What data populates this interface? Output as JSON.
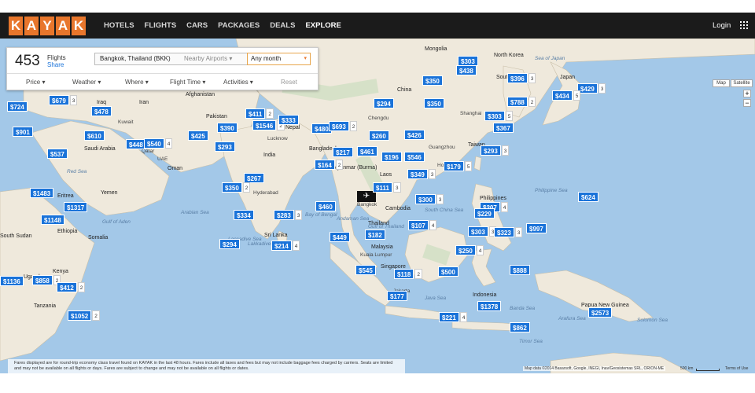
{
  "header": {
    "logo_letters": [
      "K",
      "A",
      "Y",
      "A",
      "K"
    ],
    "nav": [
      "HOTELS",
      "FLIGHTS",
      "CARS",
      "PACKAGES",
      "DEALS",
      "EXPLORE"
    ],
    "active_nav": "EXPLORE",
    "login": "Login"
  },
  "panel": {
    "count": "453",
    "flights_label": "Flights",
    "share_label": "Share",
    "origin": "Bangkok, Thailand (BKK)",
    "nearby": "Nearby Airports",
    "month": "Any month",
    "filters": [
      "Price",
      "Weather",
      "Where",
      "Flight Time",
      "Activities"
    ],
    "reset": "Reset"
  },
  "map_controls": {
    "map": "Map",
    "satellite": "Satellite",
    "zoom_in": "+",
    "zoom_out": "−"
  },
  "colors": {
    "pin": "#1a73d9",
    "water": "#a3c8e8",
    "land": "#efe9dc",
    "logo": "#e8762c"
  },
  "labels": {
    "countries": [
      "Iraq",
      "Iran",
      "Afghanistan",
      "Pakistan",
      "Saudi Arabia",
      "Yemen",
      "Eritrea",
      "Ethiopia",
      "South Sudan",
      "Kenya",
      "Tanzania",
      "India",
      "Nepal",
      "Bangladesh",
      "Myanmar (Burma)",
      "Thailand",
      "Laos",
      "Cambodia",
      "Sri Lanka",
      "Malaysia",
      "Singapore",
      "Indonesia",
      "Papua New Guinea",
      "China",
      "Mongolia",
      "North Korea",
      "South Korea",
      "Japan",
      "Taiwan",
      "Philippines",
      "Hong Kong",
      "Guangzhou",
      "Shanghai",
      "Chengdu",
      "Lucknow",
      "Hyderabad",
      "Jakarta",
      "Kuala Lumpur",
      "Lakkadives",
      "Bangkok",
      "Gulf of Thailand",
      "Red Sea",
      "Arabian Sea",
      "Bay of Bengal",
      "Andaman Sea",
      "Philippine Sea",
      "Java Sea",
      "Banda Sea",
      "Timor Sea",
      "Arafura Sea",
      "Solomon Sea",
      "Sea of Japan",
      "South China Sea",
      "Laccadive Sea",
      "Gulf of Aden",
      "Somalia",
      "Uganda",
      "Qatar",
      "Kuwait",
      "Oman",
      "UAE"
    ]
  },
  "pins": [
    {
      "p": "$303",
      "c": ""
    },
    {
      "p": "$438",
      "c": ""
    },
    {
      "p": "$396",
      "c": "3"
    },
    {
      "p": "$350",
      "c": ""
    },
    {
      "p": "$429",
      "c": "3"
    },
    {
      "p": "$679",
      "c": "3"
    },
    {
      "p": "$724",
      "c": ""
    },
    {
      "p": "$478",
      "c": ""
    },
    {
      "p": "$411",
      "c": "2"
    },
    {
      "p": "$294",
      "c": ""
    },
    {
      "p": "$350",
      "c": ""
    },
    {
      "p": "$788",
      "c": "2"
    },
    {
      "p": "$434",
      "c": "5"
    },
    {
      "p": "$1546",
      "c": "2"
    },
    {
      "p": "$333",
      "c": ""
    },
    {
      "p": "$390",
      "c": ""
    },
    {
      "p": "$480",
      "c": ""
    },
    {
      "p": "$693",
      "c": "2"
    },
    {
      "p": "$303",
      "c": "5"
    },
    {
      "p": "$367",
      "c": ""
    },
    {
      "p": "$901",
      "c": ""
    },
    {
      "p": "$610",
      "c": ""
    },
    {
      "p": "$425",
      "c": ""
    },
    {
      "p": "$448",
      "c": ""
    },
    {
      "p": "$540",
      "c": "4"
    },
    {
      "p": "$293",
      "c": ""
    },
    {
      "p": "$260",
      "c": ""
    },
    {
      "p": "$426",
      "c": ""
    },
    {
      "p": "$537",
      "c": ""
    },
    {
      "p": "$217",
      "c": ""
    },
    {
      "p": "$461",
      "c": ""
    },
    {
      "p": "$196",
      "c": ""
    },
    {
      "p": "$546",
      "c": ""
    },
    {
      "p": "$293",
      "c": "3"
    },
    {
      "p": "$164",
      "c": "2"
    },
    {
      "p": "$179",
      "c": "5"
    },
    {
      "p": "$349",
      "c": "3"
    },
    {
      "p": "$267",
      "c": ""
    },
    {
      "p": "$350",
      "c": "2"
    },
    {
      "p": "$111",
      "c": "3"
    },
    {
      "p": "$1483",
      "c": ""
    },
    {
      "p": "$300",
      "c": "3"
    },
    {
      "p": "$624",
      "c": ""
    },
    {
      "p": "$1317",
      "c": ""
    },
    {
      "p": "$460",
      "c": ""
    },
    {
      "p": "$334",
      "c": ""
    },
    {
      "p": "$283",
      "c": "3"
    },
    {
      "p": "$207",
      "c": "4"
    },
    {
      "p": "$229",
      "c": ""
    },
    {
      "p": "$1148",
      "c": ""
    },
    {
      "p": "$107",
      "c": "4"
    },
    {
      "p": "$997",
      "c": ""
    },
    {
      "p": "$303",
      "c": "3"
    },
    {
      "p": "$323",
      "c": "3"
    },
    {
      "p": "$449",
      "c": ""
    },
    {
      "p": "$182",
      "c": ""
    },
    {
      "p": "$294",
      "c": ""
    },
    {
      "p": "$214",
      "c": "4"
    },
    {
      "p": "$250",
      "c": "4"
    },
    {
      "p": "$545",
      "c": ""
    },
    {
      "p": "$118",
      "c": "2"
    },
    {
      "p": "$500",
      "c": ""
    },
    {
      "p": "$888",
      "c": ""
    },
    {
      "p": "$1136",
      "c": ""
    },
    {
      "p": "$858",
      "c": "2"
    },
    {
      "p": "$412",
      "c": "2"
    },
    {
      "p": "$177",
      "c": ""
    },
    {
      "p": "$1378",
      "c": ""
    },
    {
      "p": "$2573",
      "c": ""
    },
    {
      "p": "$1052",
      "c": "2"
    },
    {
      "p": "$221",
      "c": "4"
    },
    {
      "p": "$862",
      "c": ""
    }
  ],
  "footer": {
    "disclaimer": "Fares displayed are for round-trip economy class travel found on KAYAK in the last 48 hours. Fares include all taxes and fees but may not include baggage fees charged by carriers. Seats are limited and may not be available on all flights or days. Fares are subject to change and may not be available on all flights or dates.",
    "attribution": "Map data ©2014 Basarsoft, Google, INEGI, Inav/Geosistemas SRL, ORION-ME",
    "scale": "500 km",
    "terms": "Terms of Use"
  }
}
